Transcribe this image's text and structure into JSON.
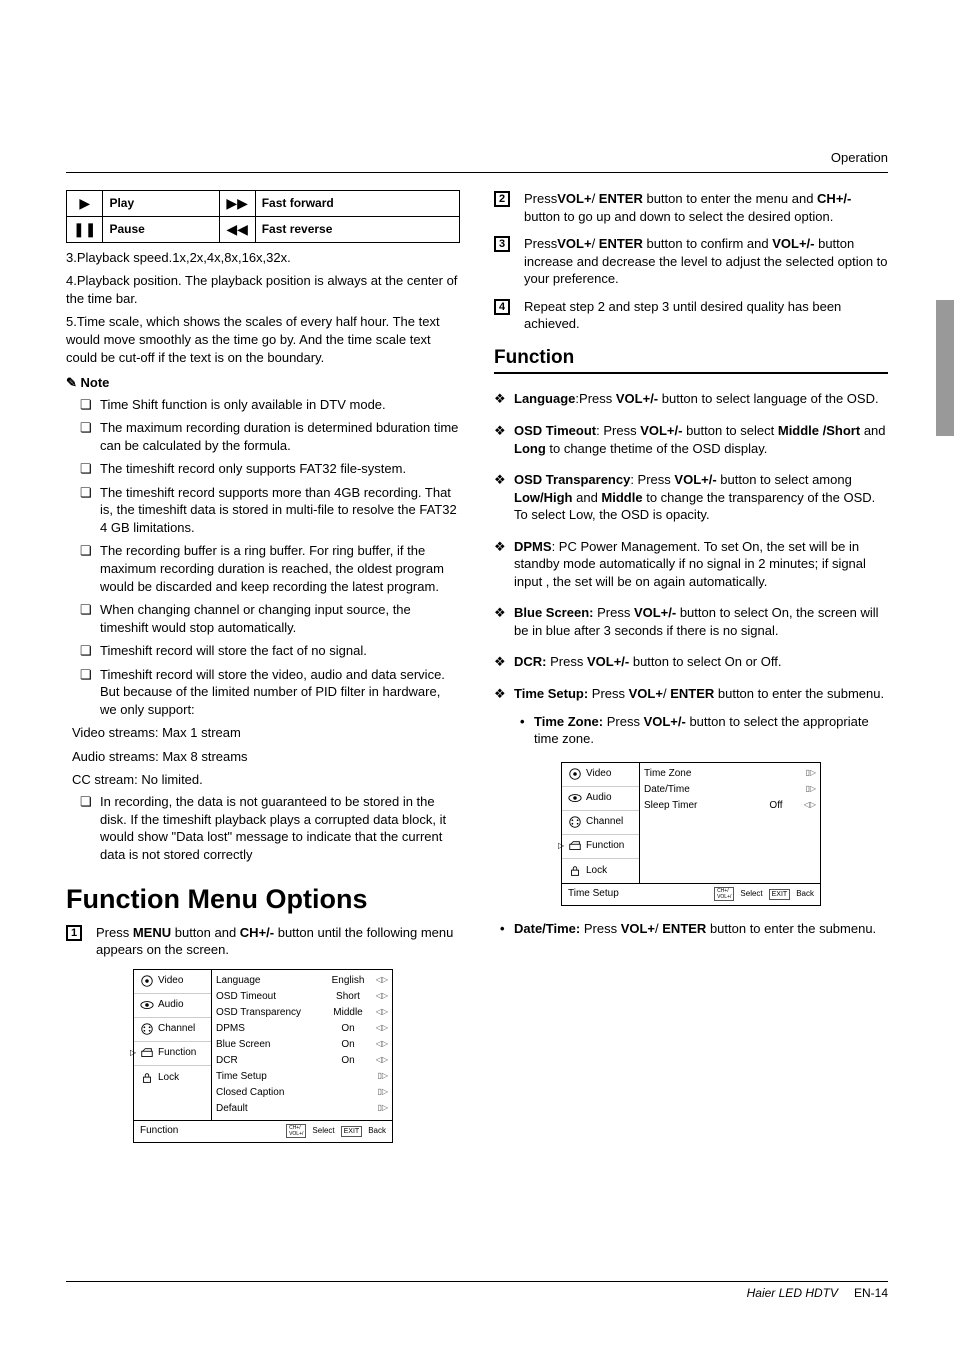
{
  "header": {
    "section": "Operation"
  },
  "playback_table": {
    "rows": [
      {
        "icon": "▶",
        "label": "Play",
        "icon2": "▶▶",
        "label2": "Fast forward"
      },
      {
        "icon": "❚❚",
        "label": "Pause",
        "icon2": "◀◀",
        "label2": "Fast reverse"
      }
    ]
  },
  "left": {
    "l3": "3.Playback speed.1x,2x,4x,8x,16x,32x.",
    "l4": "4.Playback position. The playback position is always at the center of the time bar.",
    "l5": "5.Time scale, which shows the scales of every half hour. The text would move smoothly as the time go by. And the time scale text could be cut-off if the text is on the boundary.",
    "note_label": "Note",
    "notes": [
      "Time Shift function is only available in DTV mode.",
      "The maximum recording duration is determined bduration time can be calculated by the formula.",
      "The timeshift record only supports FAT32 file-system.",
      "The timeshift record supports more than 4GB recording. That is, the timeshift data is stored in multi-file to resolve the FAT32 4 GB limitations.",
      "The recording buffer is a ring buffer. For ring buffer, if the maximum recording duration is reached, the oldest program would be discarded and keep recording the latest program.",
      "When changing channel or changing input source, the timeshift would stop automatically.",
      "Timeshift record will store the fact of no signal.",
      "Timeshift record will store the video, audio and data service. But because of the limited number of PID filter in hardware, we only support:"
    ],
    "streams": {
      "video": "Video streams:   Max 1 stream",
      "audio": "Audio streams:   Max 8 streams",
      "cc": "CC stream:    No limited."
    },
    "notes_tail": [
      "In recording, the data is not guaranteed to be stored in the disk. If the timeshift playback plays a corrupted data block, it would show \"Data lost\" message to indicate that the current data is not stored correctly"
    ],
    "fmo_title": "Function Menu Options",
    "fmo_step1_a": "Press ",
    "fmo_step1_b": "MENU",
    "fmo_step1_c": " button and ",
    "fmo_step1_d": "CH+/-",
    "fmo_step1_e": " button until the following menu appears on the screen."
  },
  "osd1": {
    "tabs": [
      "Video",
      "Audio",
      "Channel",
      "Function",
      "Lock"
    ],
    "active": 3,
    "rows": [
      {
        "label": "Language",
        "val": "English",
        "arrow": "◁▷"
      },
      {
        "label": "OSD Timeout",
        "val": "Short",
        "arrow": "◁▷"
      },
      {
        "label": "OSD Transparency",
        "val": "Middle",
        "arrow": "◁▷"
      },
      {
        "label": "DPMS",
        "val": "On",
        "arrow": "◁▷"
      },
      {
        "label": "Blue Screen",
        "val": "On",
        "arrow": "◁▷"
      },
      {
        "label": "DCR",
        "val": "On",
        "arrow": "◁▷"
      },
      {
        "label": "Time Setup",
        "val": "",
        "arrow": "▯▷"
      },
      {
        "label": "Closed Caption",
        "val": "",
        "arrow": "▯▷"
      },
      {
        "label": "Default",
        "val": "",
        "arrow": "▯▷"
      }
    ],
    "footer_title": "Function",
    "footer_sel": "Select",
    "footer_back": "Back",
    "footer_keys": "CH+/\nVOL+/",
    "footer_exit": "EXIT"
  },
  "right": {
    "step2_a": "Press",
    "step2_b": "VOL+",
    "step2_c": "/ ",
    "step2_d": "ENTER",
    "step2_e": " button to enter the menu and ",
    "step2_f": "CH+/-",
    "step2_g": " button to go up and down to select the desired option.",
    "step3_a": "Press",
    "step3_b": "VOL+",
    "step3_c": "/ ",
    "step3_d": "ENTER",
    "step3_e": " button to confirm and ",
    "step3_f": "VOL+/-",
    "step3_g": " button increase and decrease the level to adjust the selected option to your preference.",
    "step4": "Repeat step 2 and step 3 until desired quality has been achieved.",
    "function_head": "Function",
    "items": {
      "language_b": "Language",
      "language_t": ":Press ",
      "language_v": "VOL+/-",
      "language_r": " button to select language of the OSD.",
      "osdto_b": "OSD Timeout",
      "osdto_t1": ": Press ",
      "osdto_v": "VOL+/-",
      "osdto_t2": " button to select ",
      "osdto_m": "Middle /Short",
      "osdto_and": " and ",
      "osdto_l": "Long",
      "osdto_r": " to change thetime of the OSD display.",
      "osdtr_b": "OSD Transparency",
      "osdtr_t1": ": Press ",
      "osdtr_v": "VOL+/-",
      "osdtr_t2": " button to select among ",
      "osdtr_lh": "Low/High",
      "osdtr_and": " and ",
      "osdtr_m": "Middle",
      "osdtr_r": " to change the transparency of the OSD. To select Low, the OSD is opacity.",
      "dpms_b": "DPMS",
      "dpms_r": ": PC Power Management. To set On, the set will be in standby mode automatically if no signal in 2 minutes; if signal input , the set will be on again automatically.",
      "blue_b": "Blue Screen:",
      "blue_t1": " Press ",
      "blue_v": "VOL+/-",
      "blue_r": " button to select On, the screen will be in blue after 3 seconds if there is no signal.",
      "dcr_b": "DCR:",
      "dcr_t1": " Press ",
      "dcr_v": "VOL+/-",
      "dcr_r": " button to select On or Off.",
      "ts_b": "Time Setup:",
      "ts_t1": " Press ",
      "ts_v1": "VOL+",
      "ts_sl": "/ ",
      "ts_v2": "ENTER",
      "ts_r": " button to enter the submenu.",
      "tz_b": "Time Zone:",
      "tz_t1": "  Press ",
      "tz_v": "VOL+/-",
      "tz_r": " button to select the appropriate time zone.",
      "dt_b": "Date/Time:",
      "dt_t1": " Press ",
      "dt_v1": "VOL+",
      "dt_sl": "/ ",
      "dt_v2": "ENTER",
      "dt_r": " button to enter the submenu."
    }
  },
  "osd2": {
    "tabs": [
      "Video",
      "Audio",
      "Channel",
      "Function",
      "Lock"
    ],
    "active": 3,
    "rows": [
      {
        "label": "Time Zone",
        "val": "",
        "arrow": "▯▷"
      },
      {
        "label": "Date/Time",
        "val": "",
        "arrow": "▯▷"
      },
      {
        "label": "Sleep Timer",
        "val": "Off",
        "arrow": "◁▷"
      }
    ],
    "footer_title": "Time Setup",
    "footer_sel": "Select",
    "footer_back": "Back",
    "footer_keys": "CH+/\nVOL+/",
    "footer_exit": "EXIT"
  },
  "footer": {
    "model": "Haier LED HDTV",
    "page": "EN-14"
  }
}
